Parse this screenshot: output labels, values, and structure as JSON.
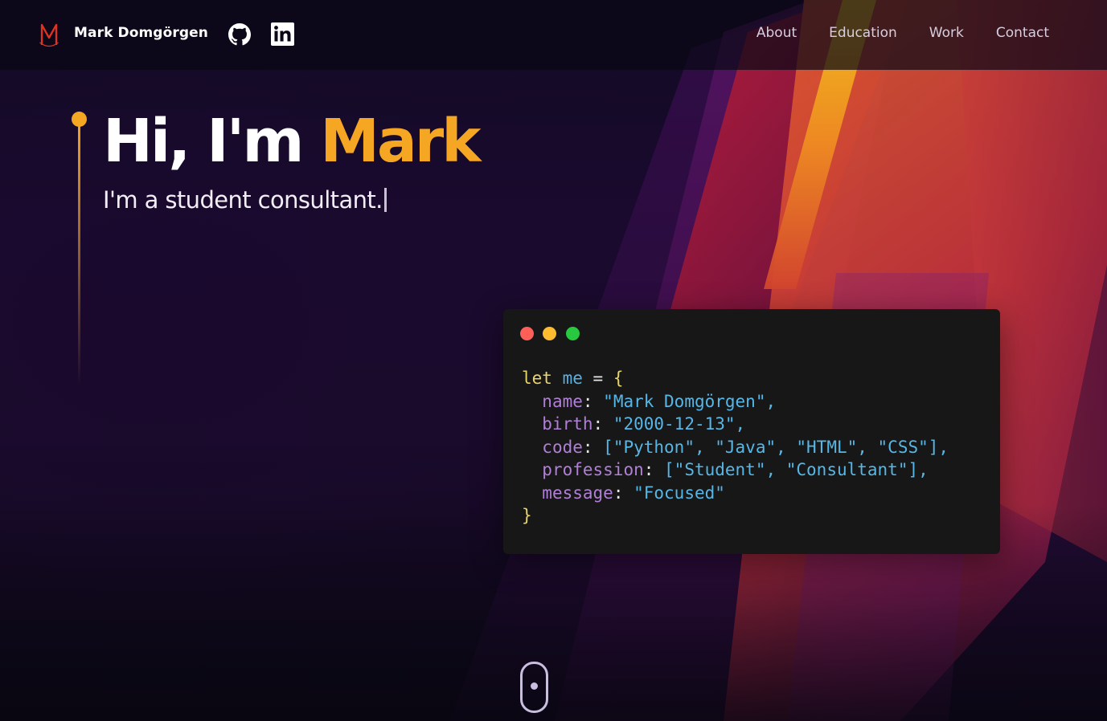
{
  "colors": {
    "accent": "#f5a623",
    "logo": "#e0321e",
    "window_red": "#ff5f57",
    "window_yellow": "#febc2e",
    "window_green": "#28c840"
  },
  "navbar": {
    "logo_icon": "m-monogram-icon",
    "brand": "Mark Domgörgen",
    "social": [
      {
        "name": "GitHub",
        "icon": "github-icon"
      },
      {
        "name": "LinkedIn",
        "icon": "linkedin-icon"
      }
    ],
    "links": [
      "About",
      "Education",
      "Work",
      "Contact"
    ]
  },
  "hero": {
    "greeting": "Hi, I'm ",
    "name": "Mark",
    "subtitle": "I'm a student consultant."
  },
  "code_window": {
    "line1": {
      "keyword": "let",
      "variable": "me",
      "operator": "=",
      "open": "{"
    },
    "fields": [
      {
        "key": "name",
        "value": "\"Mark Domgörgen\","
      },
      {
        "key": "birth",
        "value": "\"2000-12-13\","
      },
      {
        "key": "code",
        "value": "[\"Python\", \"Java\", \"HTML\", \"CSS\"],"
      },
      {
        "key": "profession",
        "value": "[\"Student\", \"Consultant\"],"
      },
      {
        "key": "message",
        "value": "\"Focused\""
      }
    ],
    "close": "}"
  },
  "scroll_indicator": {
    "icon": "mouse-scroll-icon"
  }
}
